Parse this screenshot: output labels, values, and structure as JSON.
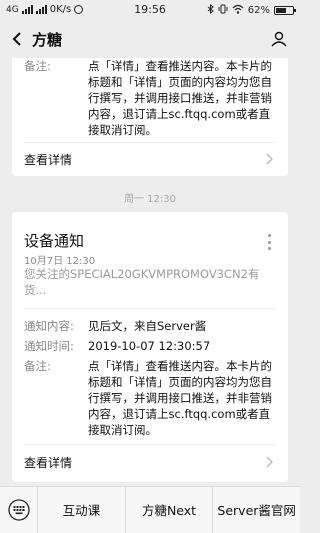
{
  "status_bar": {
    "network": "4G",
    "speed": "0K/s",
    "time": "19:56",
    "battery": "62%",
    "battery_level": 0.62
  },
  "nav": {
    "title": "方糖"
  },
  "card_top": {
    "remark_label": "备注:",
    "remark_text": "点「详情」查看推送内容。本卡片的标题和「详情」页面的内容均为您自行撰写，并调用接口推送，并非营销内容，退订请上sc.ftqq.com或者直接取消订阅。",
    "details_label": "查看详情"
  },
  "timestamp": "周一 12:30",
  "card_bottom": {
    "title": "设备通知",
    "date": "10月7日  12:30",
    "summary": "您关注的SPECIAL20GKVMPROMOV3CN2有货...",
    "content_label": "通知内容:",
    "content_value": "见后文，来自Server酱",
    "time_label": "通知时间:",
    "time_value": "2019-10-07 12:30:57",
    "remark_label": "备注:",
    "remark_text": "点「详情」查看推送内容。本卡片的标题和「详情」页面的内容均为您自行撰写，并调用接口推送，并非营销内容，退订请上sc.ftqq.com或者直接取消订阅。",
    "details_label": "查看详情"
  },
  "tabbar": {
    "tabs": [
      "互动课",
      "方糖Next",
      "Server酱官网"
    ]
  }
}
